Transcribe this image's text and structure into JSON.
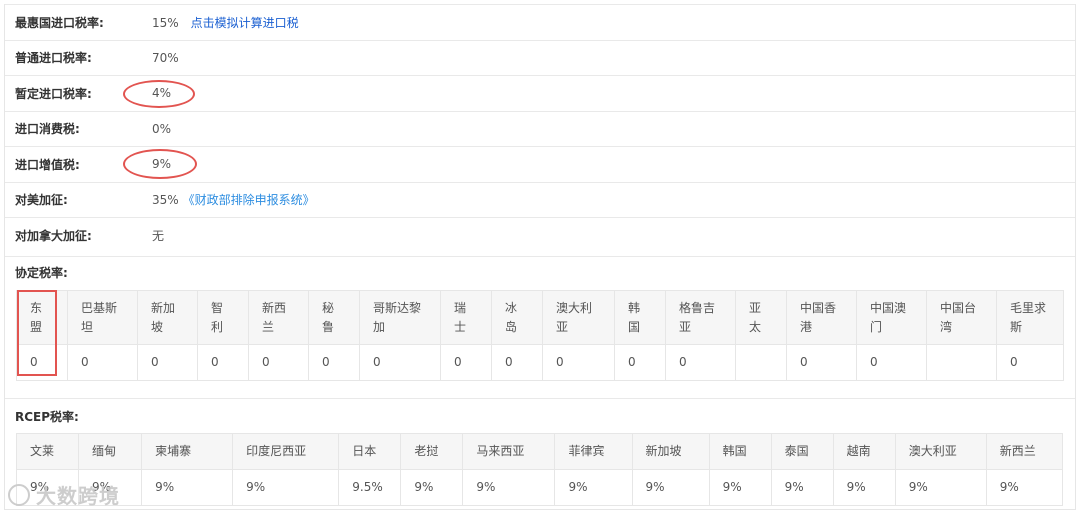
{
  "rates": [
    {
      "label": "最惠国进口税率:",
      "value": "15%",
      "link": "点击模拟计算进口税"
    },
    {
      "label": "普通进口税率:",
      "value": "70%"
    },
    {
      "label": "暂定进口税率:",
      "value": "4%"
    },
    {
      "label": "进口消费税:",
      "value": "0%"
    },
    {
      "label": "进口增值税:",
      "value": "9%"
    },
    {
      "label": "对美加征:",
      "value": "35%",
      "link": "《财政部排除申报系统》"
    },
    {
      "label": "对加拿大加征:",
      "value": "无"
    }
  ],
  "agreement": {
    "title": "协定税率:",
    "headers": [
      [
        "东",
        "盟"
      ],
      [
        "巴基斯",
        "坦"
      ],
      [
        "新加",
        "坡"
      ],
      [
        "智",
        "利"
      ],
      [
        "新西",
        "兰"
      ],
      [
        "秘",
        "鲁"
      ],
      [
        "哥斯达黎",
        "加"
      ],
      [
        "瑞",
        "士"
      ],
      [
        "冰",
        "岛"
      ],
      [
        "澳大利",
        "亚"
      ],
      [
        "韩",
        "国"
      ],
      [
        "格鲁吉",
        "亚"
      ],
      [
        "亚",
        "太"
      ],
      [
        "中国香",
        "港"
      ],
      [
        "中国澳",
        "门"
      ],
      [
        "中国台",
        "湾"
      ],
      [
        "毛里求",
        "斯"
      ]
    ],
    "values": [
      "0",
      "0",
      "0",
      "0",
      "0",
      "0",
      "0",
      "0",
      "0",
      "0",
      "0",
      "0",
      "",
      "0",
      "0",
      "",
      "0"
    ]
  },
  "rcep": {
    "title": "RCEP税率:",
    "headers": [
      "文莱",
      "缅甸",
      "柬埔寨",
      "印度尼西亚",
      "日本",
      "老挝",
      "马来西亚",
      "菲律宾",
      "新加坡",
      "韩国",
      "泰国",
      "越南",
      "澳大利亚",
      "新西兰"
    ],
    "values": [
      "9%",
      "9%",
      "9%",
      "9%",
      "9.5%",
      "9%",
      "9%",
      "9%",
      "9%",
      "9%",
      "9%",
      "9%",
      "9%",
      "9%"
    ]
  },
  "watermark": "大数跨境",
  "colors": {
    "highlight": "#e25450",
    "link": "#1a5fd1",
    "link_light": "#2d8de0",
    "header_bg": "#f6f6f6"
  }
}
